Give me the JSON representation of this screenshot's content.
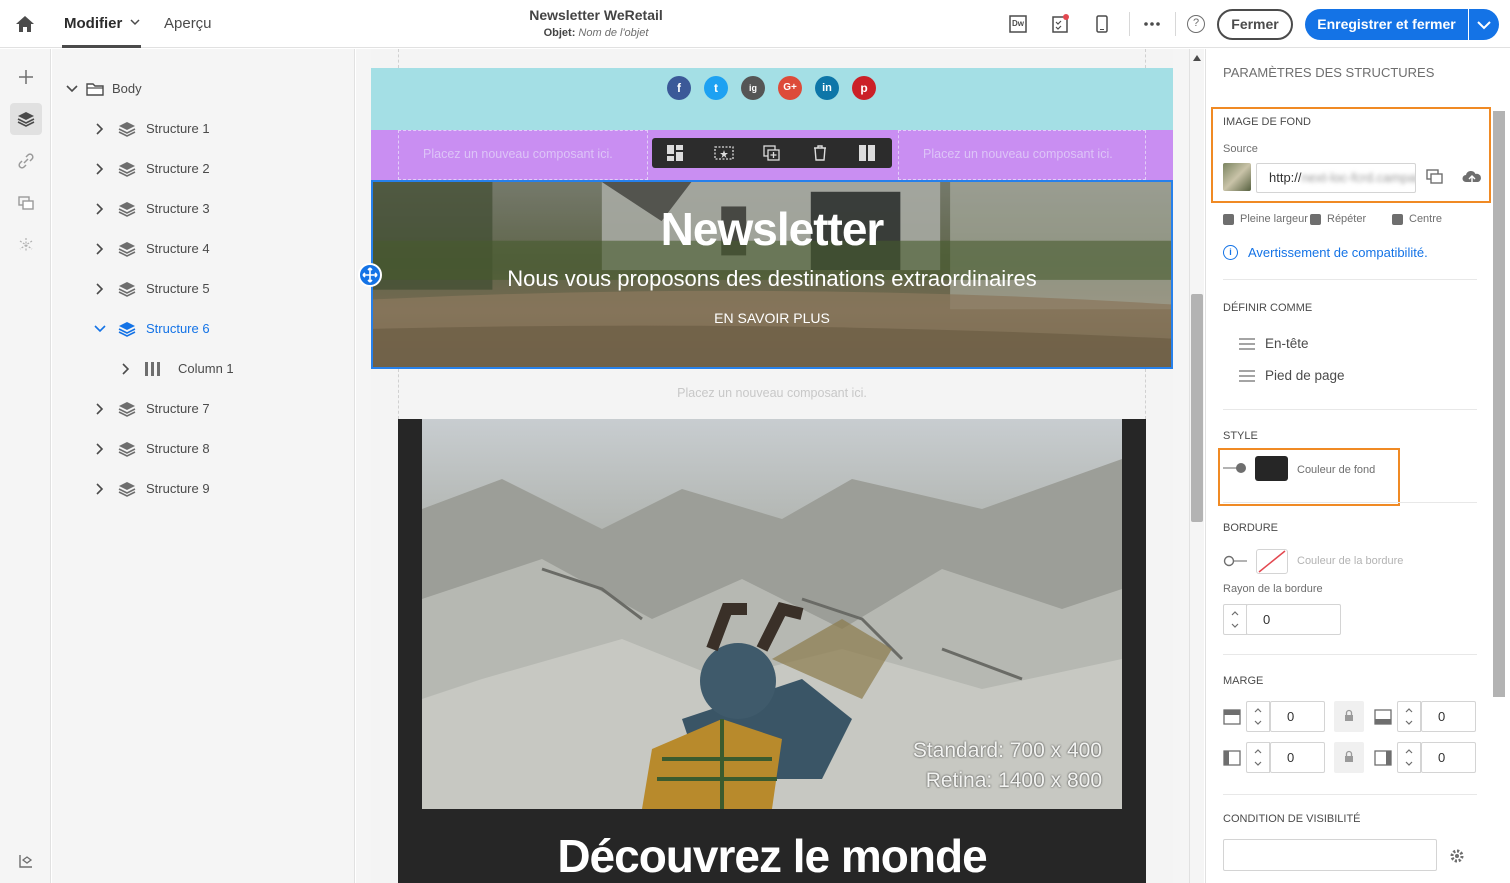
{
  "topbar": {
    "tab_modifier": "Modifier",
    "tab_apercu": "Aperçu",
    "doc_title": "Newsletter WeRetail",
    "doc_subject_label": "Objet:",
    "doc_subject_placeholder": "Nom de l'objet",
    "dw_label": "Dw",
    "btn_fermer": "Fermer",
    "btn_save": "Enregistrer et fermer"
  },
  "tree": {
    "root": "Body",
    "items": [
      {
        "label": "Structure 1"
      },
      {
        "label": "Structure 2"
      },
      {
        "label": "Structure 3"
      },
      {
        "label": "Structure 4"
      },
      {
        "label": "Structure 5"
      },
      {
        "label": "Structure 6",
        "selected": true
      },
      {
        "label": "Column 1",
        "child": true
      },
      {
        "label": "Structure 7"
      },
      {
        "label": "Structure 8"
      },
      {
        "label": "Structure 9"
      }
    ]
  },
  "canvas": {
    "social": [
      "f",
      "t",
      "ig",
      "G+",
      "in",
      "p"
    ],
    "drop_placeholder": "Placez un nouveau composant ici.",
    "hero_title": "Newsletter",
    "hero_subtitle": "Nous vous proposons des destinations extraordinaires",
    "hero_cta": "EN SAVOIR PLUS",
    "photo_line1": "Standard: 700 x 400",
    "photo_line2": "Retina: 1400 x 800",
    "dark_heading": "Découvrez le monde"
  },
  "panel": {
    "title": "PARAMÈTRES DES STRUCTURES",
    "bg_section": "IMAGE DE FOND",
    "source_label": "Source",
    "source_value_prefix": "http://",
    "source_value_blurred": "next-loc-fcrd.campaign",
    "chk_full_width": "Pleine largeur",
    "chk_repeat": "Répéter",
    "chk_center": "Centre",
    "compat_link": "Avertissement de compatibilité.",
    "define_section": "DÉFINIR COMME",
    "define_header": "En-tête",
    "define_footer": "Pied de page",
    "style_section": "STYLE",
    "bg_color_label": "Couleur de fond",
    "border_section": "BORDURE",
    "border_color_label": "Couleur de la bordure",
    "border_radius_label": "Rayon de la bordure",
    "border_radius_value": "0",
    "margin_section": "MARGE",
    "margin_top": "0",
    "margin_bottom": "0",
    "margin_left": "0",
    "margin_right": "0",
    "visibility_section": "CONDITION DE VISIBILITÉ"
  },
  "colors": {
    "accent": "#1473e6",
    "highlight": "#f08a24",
    "social_band": "#a4dfe5",
    "purple_band": "#c98ef2",
    "bg_swatch": "#262626"
  }
}
